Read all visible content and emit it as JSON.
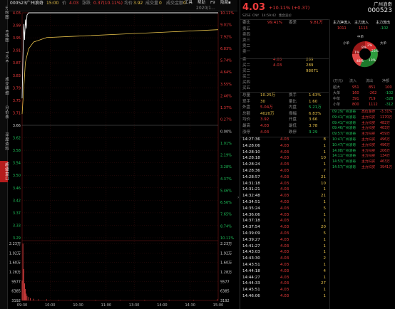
{
  "vtabs": [
    "分时图",
    "K线图",
    "TICK",
    "成交明细",
    "分价表",
    "深度资料",
    "超级盘口"
  ],
  "topbar": {
    "code_name": "000523广州浪奇",
    "time_label": "15:00",
    "price_label": "价",
    "price": "4.03",
    "change_label": "涨跌",
    "change": "0.37(10.11%)",
    "avg_label": "均价",
    "avg": "3.92",
    "vol_label": "成交量",
    "vol": "0",
    "open_int_label": "成交金额",
    "open_int": "0",
    "date": "2020/1..."
  },
  "menu": {
    "tools": "工具",
    "help": "帮助",
    "f9": "F9",
    "hide": "隐藏▪"
  },
  "chart": {
    "left_labels": [
      "4.03",
      "3.99",
      "3.95",
      "3.91",
      "3.87",
      "3.83",
      "3.79",
      "3.75",
      "3.71",
      "3.66",
      "3.62",
      "3.58",
      "3.54",
      "3.50",
      "3.46",
      "3.42",
      "3.37",
      "3.33",
      "3.29"
    ],
    "right_labels": [
      "10.11%",
      "9.01%",
      "7.92%",
      "6.83%",
      "5.74%",
      "4.64%",
      "3.55%",
      "2.46%",
      "1.37%",
      "0.27%",
      "0.00%",
      "1.01%",
      "2.19%",
      "3.28%",
      "4.37%",
      "5.46%",
      "6.56%",
      "7.65%",
      "8.74%",
      "10.11%"
    ],
    "vol_left": [
      "2.23万",
      "1.92万",
      "1.60万",
      "1.28万",
      "9577",
      "6385",
      "3192"
    ],
    "vol_right": [
      "2.23万",
      "1.92万",
      "1.60万",
      "1.28万",
      "9577",
      "6385",
      "3192"
    ],
    "times": [
      "09:30",
      "10:00",
      "10:30",
      "11:00",
      "13:30",
      "14:00",
      "14:30",
      "15:00"
    ],
    "price_line": [
      [
        0,
        0.62
      ],
      [
        1,
        0.8
      ],
      [
        2,
        0.95
      ],
      [
        3,
        0.88
      ],
      [
        4,
        0.97
      ],
      [
        5,
        0.93
      ],
      [
        6,
        0.99
      ],
      [
        8,
        1
      ],
      [
        10,
        1
      ],
      [
        240,
        1
      ]
    ],
    "avg_line": [
      [
        0,
        0.55
      ],
      [
        4,
        0.78
      ],
      [
        8,
        0.84
      ],
      [
        14,
        0.87
      ],
      [
        30,
        0.89
      ],
      [
        60,
        0.895
      ],
      [
        120,
        0.905
      ],
      [
        180,
        0.915
      ],
      [
        240,
        0.925
      ]
    ],
    "volumes": [
      [
        0,
        0.35
      ],
      [
        1,
        1
      ],
      [
        2,
        0.55
      ],
      [
        3,
        0.3
      ],
      [
        4,
        0.2
      ],
      [
        5,
        0.12
      ],
      [
        6,
        0.08
      ],
      [
        8,
        0.06
      ],
      [
        10,
        0.04
      ],
      [
        14,
        0.03
      ],
      [
        20,
        0.02
      ],
      [
        30,
        0.02
      ],
      [
        45,
        0.01
      ],
      [
        60,
        0.01
      ],
      [
        90,
        0.01
      ],
      [
        120,
        0.01
      ],
      [
        150,
        0.01
      ],
      [
        180,
        0.01
      ],
      [
        210,
        0.01
      ],
      [
        239,
        0.02
      ]
    ]
  },
  "quote": {
    "code": "000523",
    "name": "广州浪奇",
    "price": "4.03",
    "change": "+10.11%",
    "change_abs": "(+0.37)",
    "tags": [
      "SZSE",
      "CNY",
      "14:59:42",
      "集合竞价"
    ],
    "weibi_label": "委比",
    "weibi": "99.41%",
    "weicha_label": "委差",
    "weicha": "9.81万"
  },
  "flow": {
    "headers": [
      "主力净流入",
      "主力流入",
      "主力流出"
    ],
    "values": [
      "1011",
      "1113",
      "-102"
    ],
    "pie": {
      "labels": {
        "zhong": "中单",
        "xiao": "小单",
        "da": "大单"
      },
      "pcts": [
        "2%",
        "23%",
        "8%",
        "1%",
        "19%",
        "48%"
      ]
    }
  },
  "book": [
    {
      "l": "卖五",
      "p": "",
      "v": ""
    },
    {
      "l": "卖四",
      "p": "",
      "v": ""
    },
    {
      "l": "卖三",
      "p": "",
      "v": ""
    },
    {
      "l": "卖二",
      "p": "",
      "v": ""
    },
    {
      "l": "卖一",
      "p": "",
      "v": ""
    },
    {
      "l": "卖一",
      "p": "4.03",
      "v": "289"
    },
    {
      "l": "买二",
      "p": "4.03",
      "v": "289"
    },
    {
      "l": "买二",
      "p": "",
      "v": "98071"
    },
    {
      "l": "买三",
      "p": "",
      "v": ""
    },
    {
      "l": "买四",
      "p": "",
      "v": ""
    },
    {
      "l": "买五",
      "p": "",
      "v": ""
    }
  ],
  "flow_table": {
    "headers": [
      "(万元)",
      "流入",
      "流出",
      "净额"
    ],
    "rows": [
      [
        "超大",
        "951",
        "851",
        "100"
      ],
      [
        "大单",
        "160",
        "-262",
        "-102"
      ],
      [
        "中单",
        "391",
        "719",
        "-328"
      ],
      [
        "小单",
        "800",
        "1112",
        "-312"
      ]
    ]
  },
  "stats": [
    [
      "总量",
      "10.25万",
      "换手",
      "1.63%"
    ],
    [
      "现手",
      "30",
      "量比",
      "1.60"
    ],
    [
      "外盘",
      "5.04万",
      "内盘",
      "5.21万"
    ],
    [
      "总额",
      "4020万",
      "振幅",
      "6.83%"
    ],
    [
      "均价",
      "3.92",
      "开盘",
      "3.66"
    ],
    [
      "最高",
      "4.03",
      "最低",
      "3.78"
    ],
    [
      "涨停",
      "4.03",
      "跌停",
      "3.29"
    ]
  ],
  "events": [
    [
      "09:29",
      "广州浪奇",
      "高位涨停",
      "-3.31%"
    ],
    [
      "09:41",
      "广州浪奇",
      "主力扫买",
      "1170万"
    ],
    [
      "09:41",
      "广州浪奇",
      "主力扫买",
      "482万"
    ],
    [
      "09:46",
      "广州浪奇",
      "主力扫买",
      "403万"
    ],
    [
      "09:57",
      "广州浪奇",
      "主力扫买",
      "459万"
    ],
    [
      "10:47",
      "广州浪奇",
      "主力扫买",
      "496万"
    ],
    [
      "10:47",
      "广州浪奇",
      "主力扫买",
      "496万"
    ],
    [
      "14:08",
      "广州浪奇",
      "主力扫买",
      "206万"
    ],
    [
      "14:11",
      "广州浪奇",
      "主力扫买",
      "134万"
    ],
    [
      "14:53",
      "广州浪奇",
      "主力扫买",
      "463万"
    ],
    [
      "14:57",
      "广州浪奇",
      "主力扫买",
      "3941万"
    ]
  ],
  "ticks": [
    [
      "14:27:36",
      "4.03",
      "8"
    ],
    [
      "14:28:06",
      "4.03",
      "1"
    ],
    [
      "14:28:10",
      "4.03",
      "1"
    ],
    [
      "14:28:18",
      "4.03",
      "10"
    ],
    [
      "14:28:24",
      "4.03",
      "1"
    ],
    [
      "14:28:36",
      "4.03",
      "7"
    ],
    [
      "14:28:57",
      "4.03",
      "21"
    ],
    [
      "14:31:18",
      "4.03",
      "10"
    ],
    [
      "14:31:21",
      "4.03",
      "1"
    ],
    [
      "14:32:48",
      "4.03",
      "21"
    ],
    [
      "14:34:51",
      "4.03",
      "1"
    ],
    [
      "14:35:24",
      "4.03",
      "5"
    ],
    [
      "14:36:06",
      "4.03",
      "1"
    ],
    [
      "14:37:18",
      "4.03",
      "1"
    ],
    [
      "14:37:54",
      "4.03",
      "20"
    ],
    [
      "14:39:09",
      "4.03",
      "5"
    ],
    [
      "14:39:27",
      "4.03",
      "1"
    ],
    [
      "14:41:27",
      "4.03",
      "1"
    ],
    [
      "14:43:03",
      "4.03",
      "1"
    ],
    [
      "14:43:30",
      "4.03",
      "2"
    ],
    [
      "14:43:51",
      "4.03",
      "1"
    ],
    [
      "14:44:18",
      "4.03",
      "4"
    ],
    [
      "14:44:27",
      "4.03",
      "1"
    ],
    [
      "14:44:33",
      "4.03",
      "27"
    ],
    [
      "14:45:51",
      "4.03",
      "1"
    ],
    [
      "14:46:06",
      "4.03",
      "1"
    ]
  ]
}
